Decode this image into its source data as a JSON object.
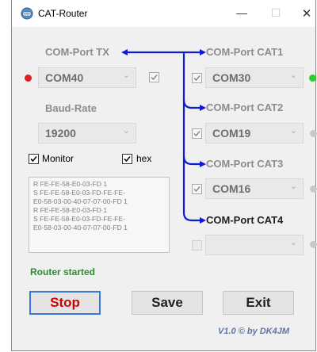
{
  "window": {
    "title": "CAT-Router",
    "minimize": "—",
    "maximize": "☐",
    "close": "✕"
  },
  "tx": {
    "label": "COM-Port TX",
    "port": "COM40",
    "indicator_color": "#e11f1f"
  },
  "baud": {
    "label": "Baud-Rate",
    "value": "19200"
  },
  "options": {
    "monitor_label": "Monitor",
    "hex_label": "hex"
  },
  "cat_ports": [
    {
      "label": "COM-Port CAT1",
      "port": "COM30",
      "enabled": true,
      "indicator_color": "#2ecc2e"
    },
    {
      "label": "COM-Port CAT2",
      "port": "COM19",
      "enabled": true,
      "indicator_color": "#c8c8c8"
    },
    {
      "label": "COM-Port CAT3",
      "port": "COM16",
      "enabled": true,
      "indicator_color": "#c8c8c8"
    },
    {
      "label": "COM-Port CAT4",
      "port": "",
      "enabled": false,
      "indicator_color": "#c8c8c8"
    }
  ],
  "log": [
    "R FE-FE-58-E0-03-FD 1",
    "S FE-FE-58-E0-03-FD-FE-FE-",
    "E0-58-03-00-40-07-07-00-FD 1",
    "R FE-FE-58-E0-03-FD 1",
    "S FE-FE-58-E0-03-FD-FE-FE-",
    "E0-58-03-00-40-07-07-00-FD 1"
  ],
  "status": "Router started",
  "buttons": {
    "stop": "Stop",
    "save": "Save",
    "exit": "Exit"
  },
  "version": "V1.0 © by DK4JM",
  "colors": {
    "arrow": "#0d1ad6"
  }
}
